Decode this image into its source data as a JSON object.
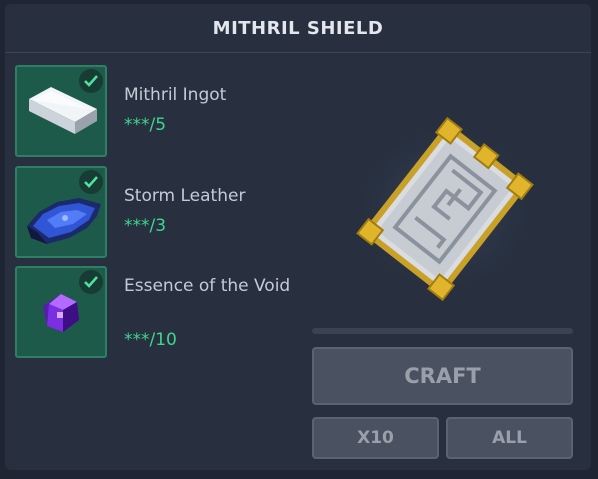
{
  "title": "MITHRIL SHIELD",
  "ingredients": [
    {
      "name": "Mithril Ingot",
      "count": "***/5",
      "icon": "mithril-ingot-icon"
    },
    {
      "name": "Storm Leather",
      "count": "***/3",
      "icon": "storm-leather-icon"
    },
    {
      "name": "Essence of the Void",
      "count": "***/10",
      "icon": "void-essence-icon"
    }
  ],
  "craft_progress": 0,
  "buttons": {
    "craft": "CRAFT",
    "x10": "X10",
    "all": "ALL"
  },
  "colors": {
    "slot_bg": "#1e5a49",
    "count_green": "#3fd68e",
    "button_disabled": "#4a5160"
  }
}
